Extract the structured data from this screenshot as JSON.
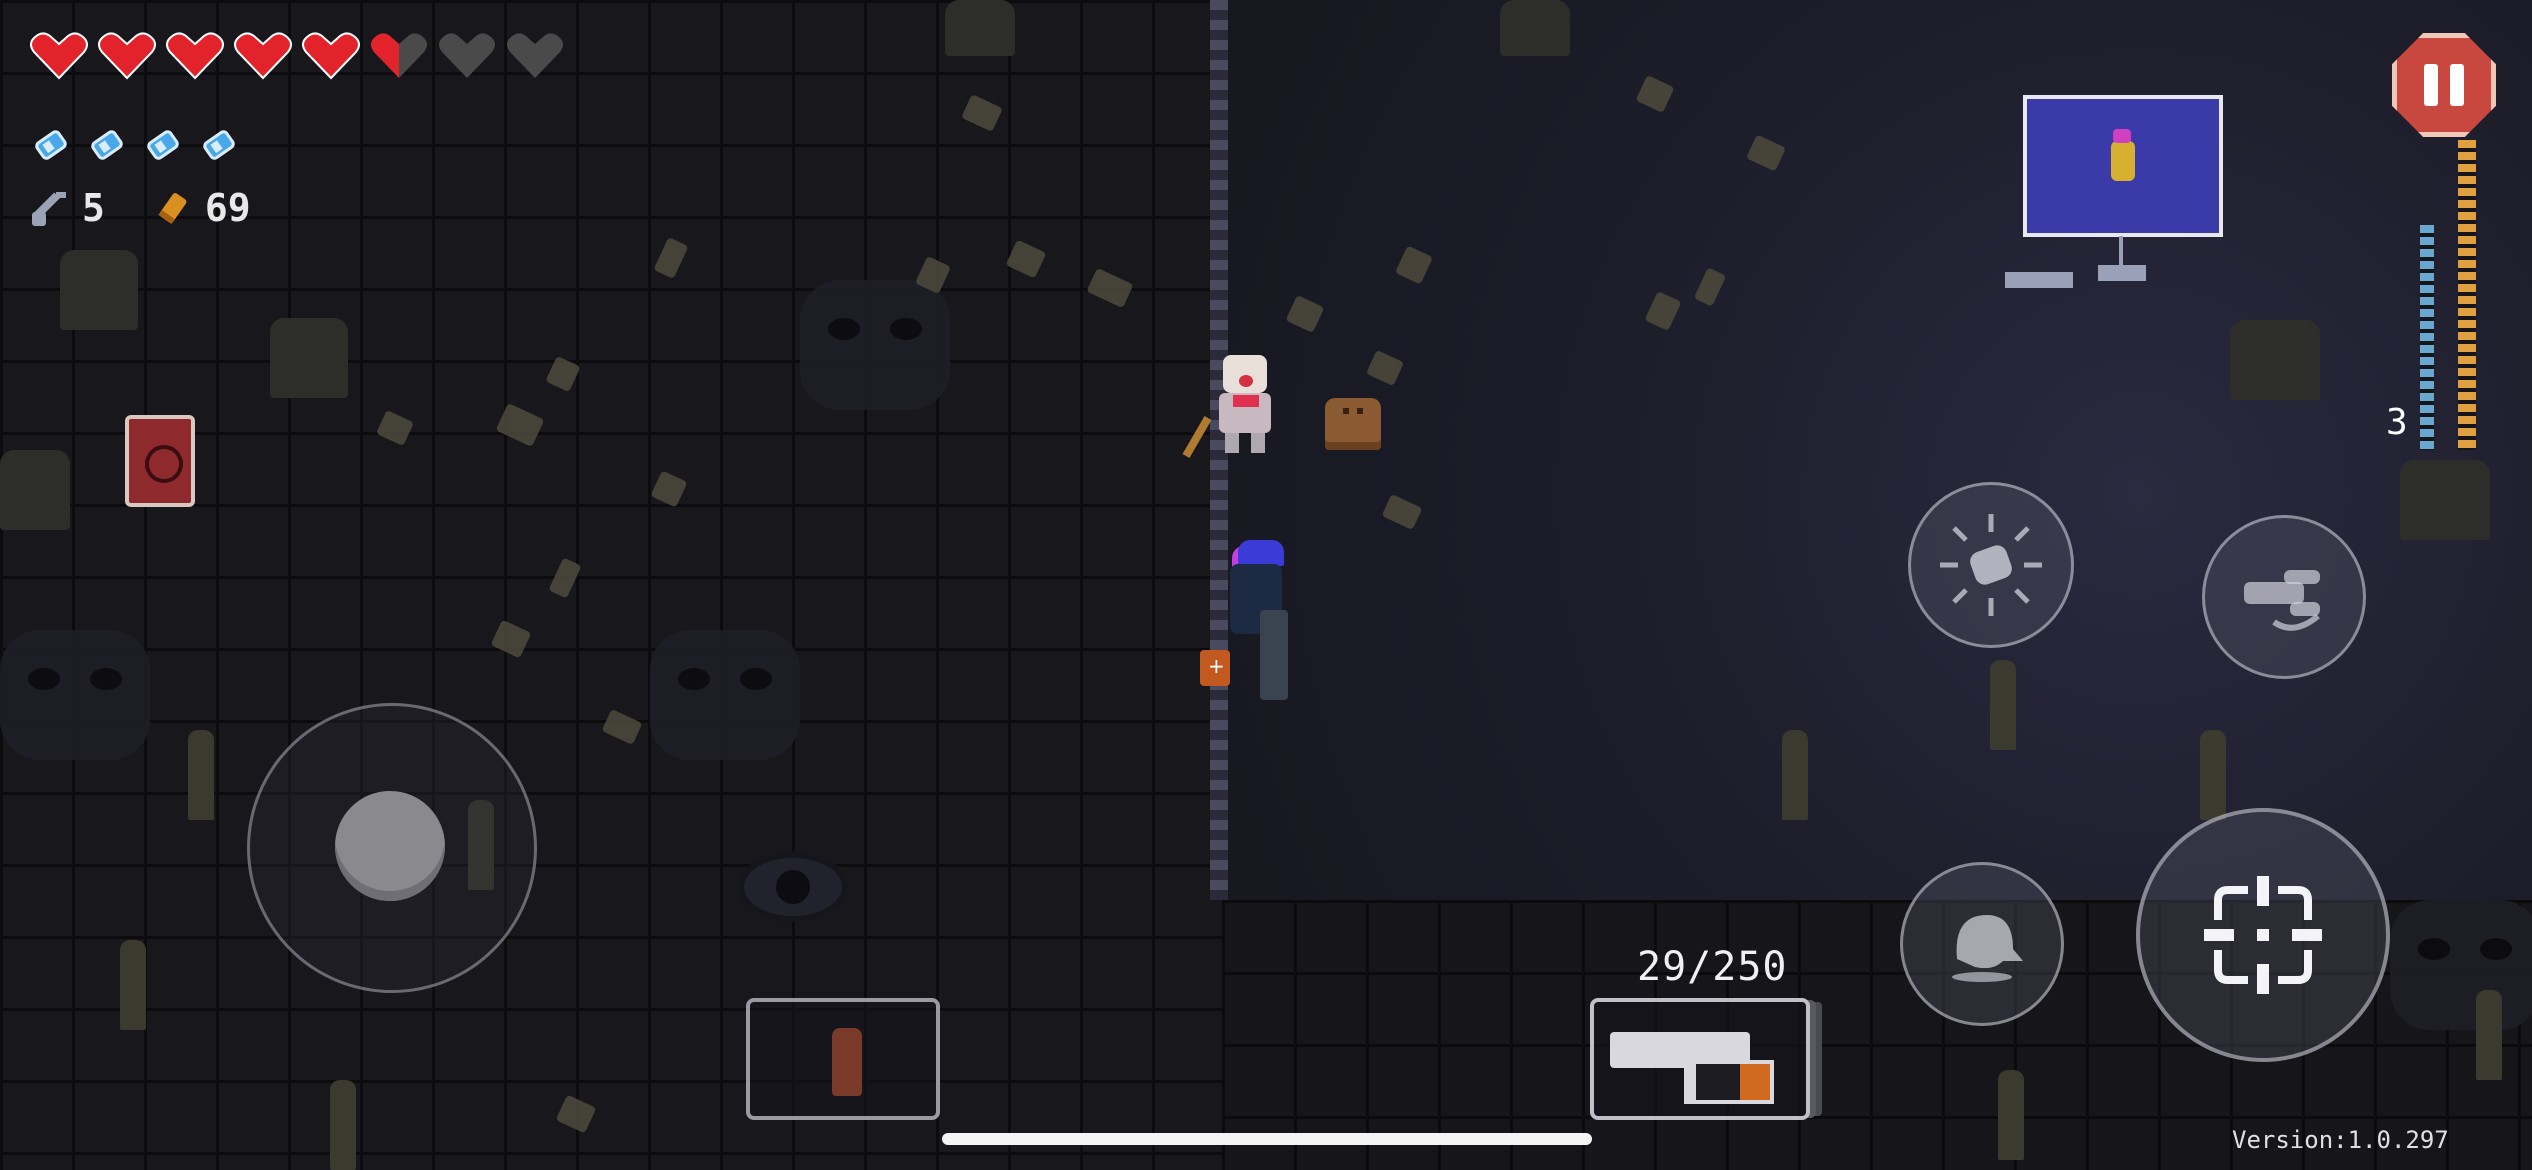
{
  "hud": {
    "hearts": [
      "full",
      "full",
      "full",
      "full",
      "full",
      "half",
      "empty",
      "empty"
    ],
    "blanks_count": 4,
    "keys": "5",
    "shells": "69"
  },
  "weapon": {
    "ammo": "29/250",
    "clip_remaining": "3"
  },
  "footer": {
    "version": "Version:1.0.297"
  },
  "icons": {
    "pause": "pause-icon",
    "blank": "blank-burst-icon",
    "interact": "interact-hand-icon",
    "dodge": "dodge-roll-icon",
    "fire": "crosshair-icon",
    "key": "key-icon",
    "shell": "shell-casing-icon",
    "heart": "heart-icon"
  },
  "colors": {
    "heart_red": "#e3232b",
    "heart_empty": "#4a4a4a",
    "blank_blue": "#4aa8e8",
    "pause_red": "#c84840",
    "minimap_room": "#3a3aa8"
  }
}
